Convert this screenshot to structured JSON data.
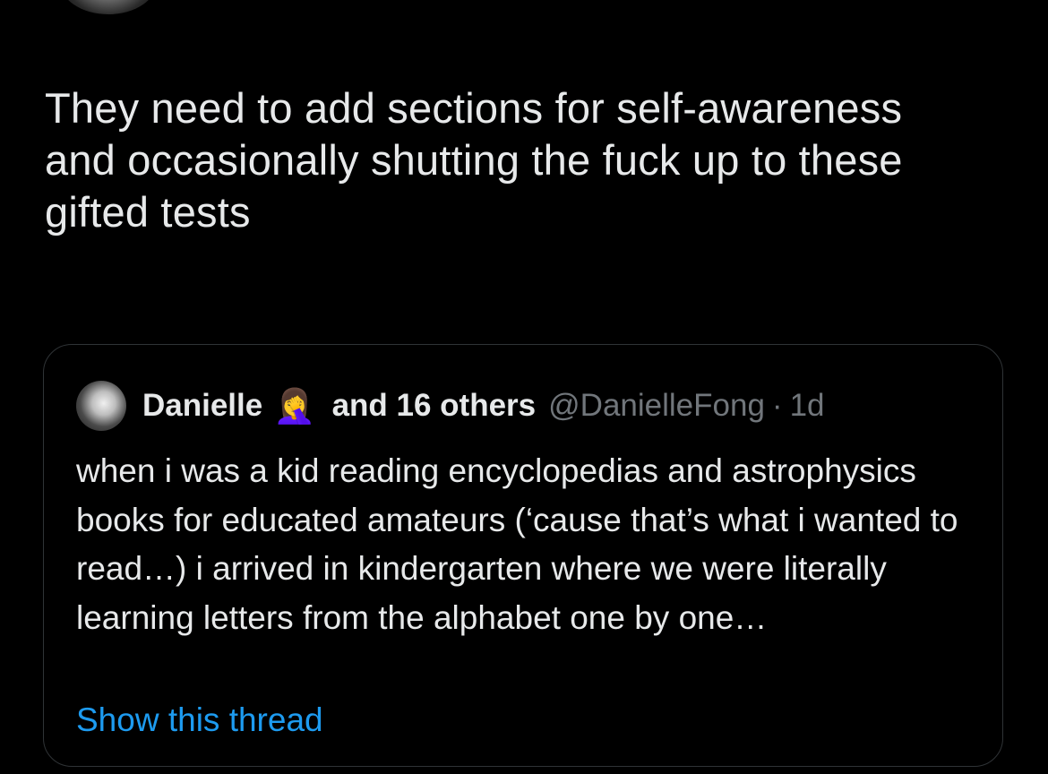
{
  "tweet": {
    "text": "They need to add sections for self-awareness and occasionally shutting the fuck up to these gifted tests"
  },
  "quote": {
    "display_name": "Danielle",
    "emoji": "🤦‍♀️",
    "others": "and 16 others",
    "handle": "@DanielleFong",
    "separator": "·",
    "time": "1d",
    "text": "when i was a kid reading encyclopedias and astrophysics books for educated amateurs (‘cause that’s what i wanted to read…) i arrived in kindergarten where we were literally learning letters from the alphabet one by one…",
    "show_thread": "Show this thread"
  },
  "colors": {
    "background": "#000000",
    "text": "#e7e9ea",
    "muted": "#71767b",
    "border": "#2f3336",
    "link": "#1d9bf0"
  }
}
